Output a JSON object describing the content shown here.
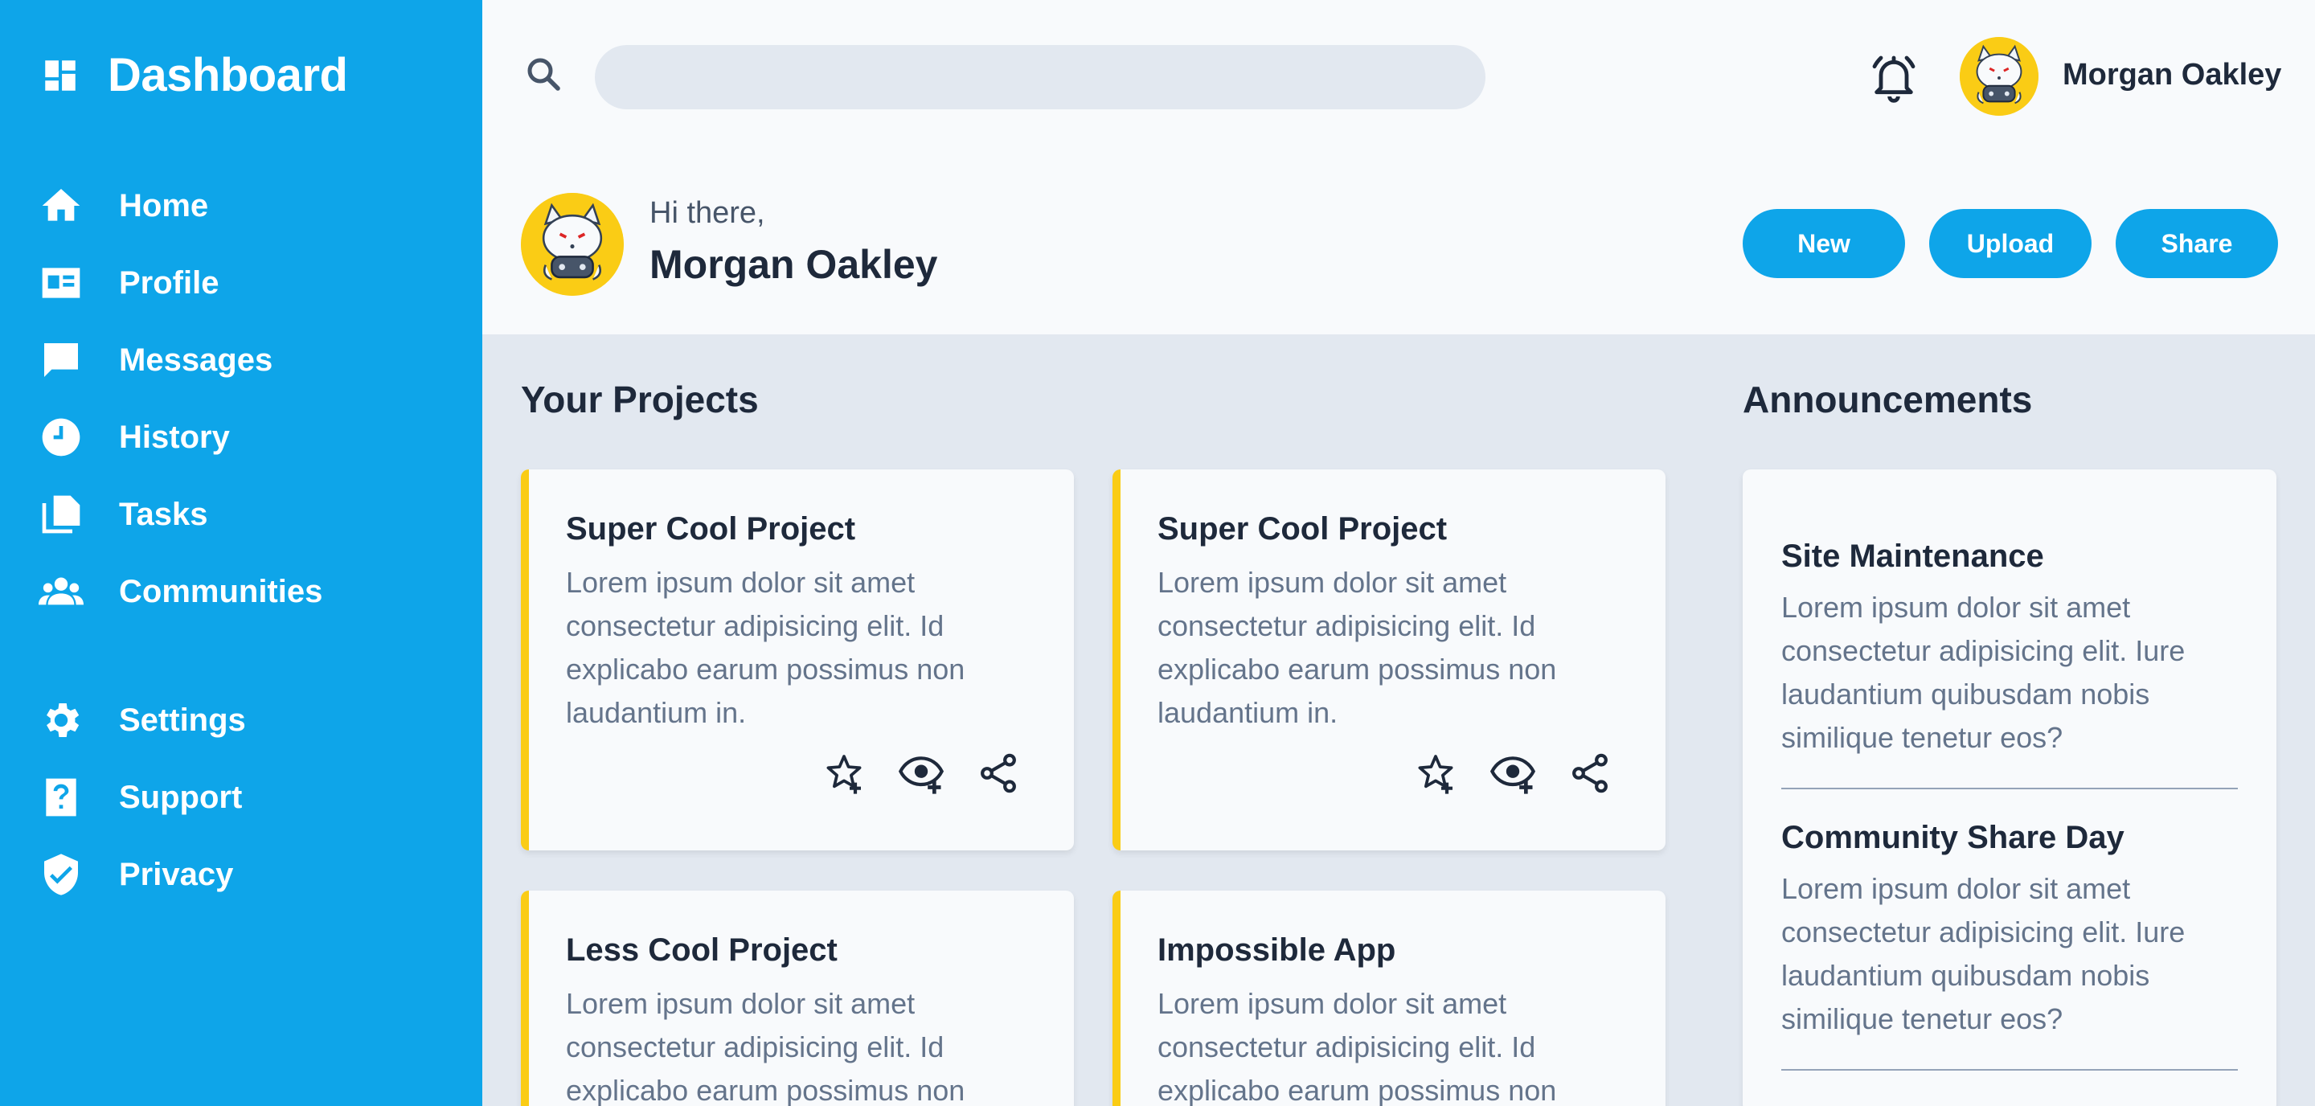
{
  "sidebar": {
    "brand": "Dashboard",
    "items": [
      {
        "label": "Home",
        "icon": "home-icon"
      },
      {
        "label": "Profile",
        "icon": "profile-card-icon"
      },
      {
        "label": "Messages",
        "icon": "message-icon"
      },
      {
        "label": "History",
        "icon": "clock-icon"
      },
      {
        "label": "Tasks",
        "icon": "documents-icon"
      },
      {
        "label": "Communities",
        "icon": "group-icon"
      },
      {
        "label": "Settings",
        "icon": "gear-icon"
      },
      {
        "label": "Support",
        "icon": "question-icon"
      },
      {
        "label": "Privacy",
        "icon": "shield-icon"
      }
    ]
  },
  "topbar": {
    "search_placeholder": "",
    "user_name": "Morgan Oakley"
  },
  "greeting": {
    "hi": "Hi there,",
    "name": "Morgan Oakley",
    "buttons": [
      "New",
      "Upload",
      "Share"
    ]
  },
  "projects": {
    "title": "Your Projects",
    "cards": [
      {
        "title": "Super Cool Project",
        "body": "Lorem ipsum dolor sit amet consectetur adipisicing elit. Id explicabo earum possimus non laudantium in."
      },
      {
        "title": "Super Cool Project",
        "body": "Lorem ipsum dolor sit amet consectetur adipisicing elit. Id explicabo earum possimus non laudantium in."
      },
      {
        "title": "Less Cool Project",
        "body": "Lorem ipsum dolor sit amet consectetur adipisicing elit. Id explicabo earum possimus non laudantium in."
      },
      {
        "title": "Impossible App",
        "body": "Lorem ipsum dolor sit amet consectetur adipisicing elit. Id explicabo earum possimus non laudantium in."
      }
    ]
  },
  "announcements": {
    "title": "Announcements",
    "items": [
      {
        "title": "Site Maintenance",
        "body": "Lorem ipsum dolor sit amet consectetur adipisicing elit. Iure laudantium quibusdam nobis similique tenetur eos?"
      },
      {
        "title": "Community Share Day",
        "body": "Lorem ipsum dolor sit amet consectetur adipisicing elit. Iure laudantium quibusdam nobis similique tenetur eos?"
      }
    ]
  },
  "colors": {
    "accent": "#0ea5e9",
    "card_border": "#facc15",
    "background": "#e2e8f0",
    "surface": "#f8fafc"
  }
}
